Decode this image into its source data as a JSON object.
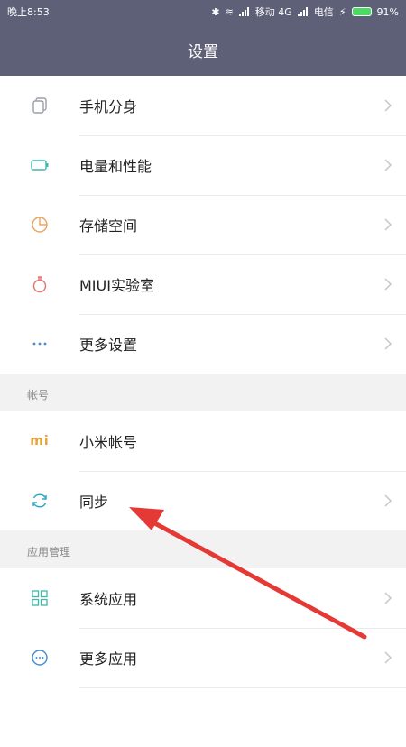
{
  "status_bar": {
    "time": "晚上8:53",
    "carrier1": "移动 4G",
    "carrier2": "电信",
    "battery": "91%"
  },
  "header": {
    "title": "设置"
  },
  "groups": [
    {
      "items": [
        {
          "label": "手机分身",
          "icon": "copy-icon"
        },
        {
          "label": "电量和性能",
          "icon": "battery-icon"
        },
        {
          "label": "存储空间",
          "icon": "pie-chart-icon"
        },
        {
          "label": "MIUI实验室",
          "icon": "flask-icon"
        },
        {
          "label": "更多设置",
          "icon": "more-dots-icon"
        }
      ]
    }
  ],
  "account_section": {
    "header": "帐号",
    "items": [
      {
        "label": "小米帐号",
        "icon": "mi-logo-icon"
      },
      {
        "label": "同步",
        "icon": "sync-icon"
      }
    ]
  },
  "apps_section": {
    "header": "应用管理",
    "items": [
      {
        "label": "系统应用",
        "icon": "grid-icon"
      },
      {
        "label": "更多应用",
        "icon": "more-circle-icon"
      }
    ]
  },
  "colors": {
    "header_bg": "#5e6078",
    "annotation_arrow": "#e53935"
  }
}
